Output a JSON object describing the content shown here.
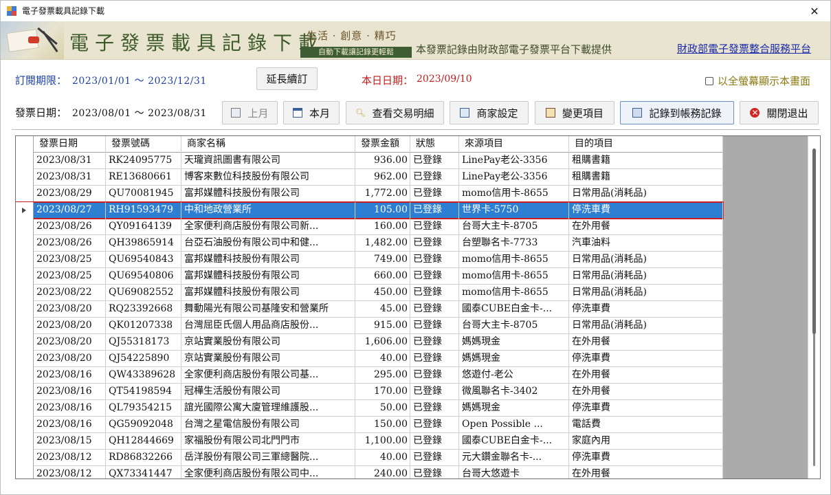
{
  "window": {
    "title": "電子發票載具記錄下載",
    "close": "✕"
  },
  "banner": {
    "title": "電子發票載具記錄下載",
    "slogan": "生活 · 創意 · 精巧",
    "slogan_sub": "自動下載讓記錄更輕鬆",
    "source": "本發票記錄由財政部電子發票平台下載提供",
    "link": "財政部電子發票整合服務平台"
  },
  "subscription": {
    "label": "訂閱期限：",
    "range": "2023/01/01 ～ 2023/12/31",
    "extend_button": "延長續訂",
    "today_label": "本日日期：",
    "today_value": "2023/09/10",
    "fullscreen_label": "以全螢幕顯示本畫面",
    "fullscreen_checked": false
  },
  "invoice": {
    "label": "發票日期：",
    "range": "2023/08/01 ～ 2023/08/31"
  },
  "toolbar": {
    "prev": "上月",
    "month": "本月",
    "details": "查看交易明細",
    "merchant": "商家設定",
    "change": "變更項目",
    "record": "記錄到帳務記錄",
    "exit": "關閉退出"
  },
  "table": {
    "columns": [
      "發票日期",
      "發票號碼",
      "商家名稱",
      "發票金額",
      "狀態",
      "來源項目",
      "目的項目"
    ],
    "selected_index": 3,
    "rows": [
      [
        "2023/08/31",
        "RK24095775",
        "天瓏資訊圖書有限公司",
        "936.00",
        "已登錄",
        "LinePay老公-3356",
        "租購書籍"
      ],
      [
        "2023/08/31",
        "RE13680661",
        "博客來數位科技股份有限公司",
        "962.00",
        "已登錄",
        "LinePay老公-3356",
        "租購書籍"
      ],
      [
        "2023/08/29",
        "QU70081945",
        "富邦媒體科技股份有限公司",
        "1,772.00",
        "已登錄",
        "momo信用卡-8655",
        "日常用品(消耗品)"
      ],
      [
        "2023/08/27",
        "RH91593479",
        "中和地政營業所",
        "105.00",
        "已登錄",
        "世界卡-5750",
        "停洗車費"
      ],
      [
        "2023/08/26",
        "QY09164139",
        "全家便利商店股份有限公司新...",
        "160.00",
        "已登錄",
        "台哥大主卡-8705",
        "在外用餐"
      ],
      [
        "2023/08/26",
        "QH39865914",
        "台亞石油股份有限公司中和健...",
        "1,482.00",
        "已登錄",
        "台塑聯名卡-7733",
        "汽車油料"
      ],
      [
        "2023/08/25",
        "QU69540843",
        "富邦媒體科技股份有限公司",
        "749.00",
        "已登錄",
        "momo信用卡-8655",
        "日常用品(消耗品)"
      ],
      [
        "2023/08/25",
        "QU69540806",
        "富邦媒體科技股份有限公司",
        "660.00",
        "已登錄",
        "momo信用卡-8655",
        "日常用品(消耗品)"
      ],
      [
        "2023/08/22",
        "QU69082552",
        "富邦媒體科技股份有限公司",
        "450.00",
        "已登錄",
        "momo信用卡-8655",
        "日常用品(消耗品)"
      ],
      [
        "2023/08/20",
        "RQ23392668",
        "舞動陽光有限公司基隆安和營業所",
        "45.00",
        "已登錄",
        "國泰CUBE白金卡-...",
        "停洗車費"
      ],
      [
        "2023/08/20",
        "QK01207338",
        "台灣屈臣氏個人用品商店股份...",
        "915.00",
        "已登錄",
        "台哥大主卡-8705",
        "日常用品(消耗品)"
      ],
      [
        "2023/08/20",
        "QJ55318173",
        "京站實業股份有限公司",
        "1,606.00",
        "已登錄",
        "媽媽現金",
        "在外用餐"
      ],
      [
        "2023/08/20",
        "QJ54225890",
        "京站實業股份有限公司",
        "40.00",
        "已登錄",
        "媽媽現金",
        "停洗車費"
      ],
      [
        "2023/08/16",
        "QW43389628",
        "全家便利商店股份有限公司基...",
        "295.00",
        "已登錄",
        "悠遊付-老公",
        "在外用餐"
      ],
      [
        "2023/08/16",
        "QT54198594",
        "冠樺生活股份有限公司",
        "170.00",
        "已登錄",
        "微風聯名卡-3402",
        "在外用餐"
      ],
      [
        "2023/08/16",
        "QL79354215",
        "誼光國際公寓大廈管理維護股...",
        "50.00",
        "已登錄",
        "媽媽現金",
        "停洗車費"
      ],
      [
        "2023/08/16",
        "QG59092048",
        "台灣之星電信股份有限公司",
        "150.00",
        "已登錄",
        "Open Possible ...",
        "電話費"
      ],
      [
        "2023/08/15",
        "QH12844669",
        "家福股份有限公司北門門市",
        "1,100.00",
        "已登錄",
        "國泰CUBE白金卡-...",
        "家庭內用"
      ],
      [
        "2023/08/12",
        "RD86832266",
        "岳洋股份有限公司三軍總醫院...",
        "40.00",
        "已登錄",
        "元大鑽金聯名卡-...",
        "停洗車費"
      ],
      [
        "2023/08/12",
        "QX73341447",
        "全家便利商店股份有限公司中...",
        "240.00",
        "已登錄",
        "台哥大悠遊卡",
        "在外用餐"
      ]
    ]
  }
}
